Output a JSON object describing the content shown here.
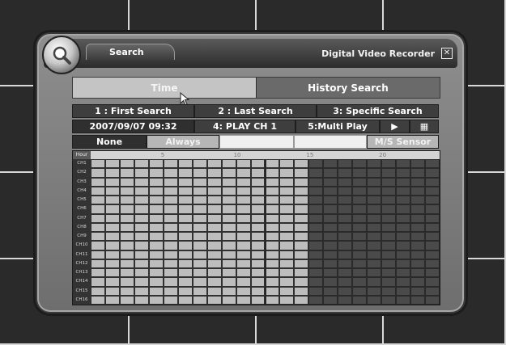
{
  "window": {
    "tab_label": "Search",
    "app_title": "Digital Video Recorder",
    "close_glyph": "✕"
  },
  "mode_tabs": [
    {
      "label": "Time",
      "state": "selected"
    },
    {
      "label": "History Search",
      "state": "normal"
    }
  ],
  "search_options": [
    {
      "label": "1 : First Search"
    },
    {
      "label": "2 : Last Search"
    },
    {
      "label": "3: Specific Search"
    }
  ],
  "play_row": {
    "datetime": "2007/09/07  09:32",
    "play_channel": "4: PLAY CH 1",
    "multi_play": "5:Multi Play",
    "play_glyph": "▶",
    "grid_glyph": "▦"
  },
  "filter_row": {
    "none_label": "None",
    "always_label": "Always",
    "motion_sensor_label": "M/S Sensor"
  },
  "timeline": {
    "header_title": "Hour",
    "hour_ticks": [
      "5",
      "10",
      "15",
      "20"
    ],
    "channels": [
      "CH1",
      "CH2",
      "CH3",
      "CH4",
      "CH5",
      "CH6",
      "CH7",
      "CH8",
      "CH9",
      "CH10",
      "CH11",
      "CH12",
      "CH13",
      "CH14",
      "CH15",
      "CH16"
    ],
    "columns": 24,
    "recorded_hours": 15,
    "colors": {
      "recorded": "#bdbdbd",
      "empty": "#4a4a4a"
    }
  }
}
